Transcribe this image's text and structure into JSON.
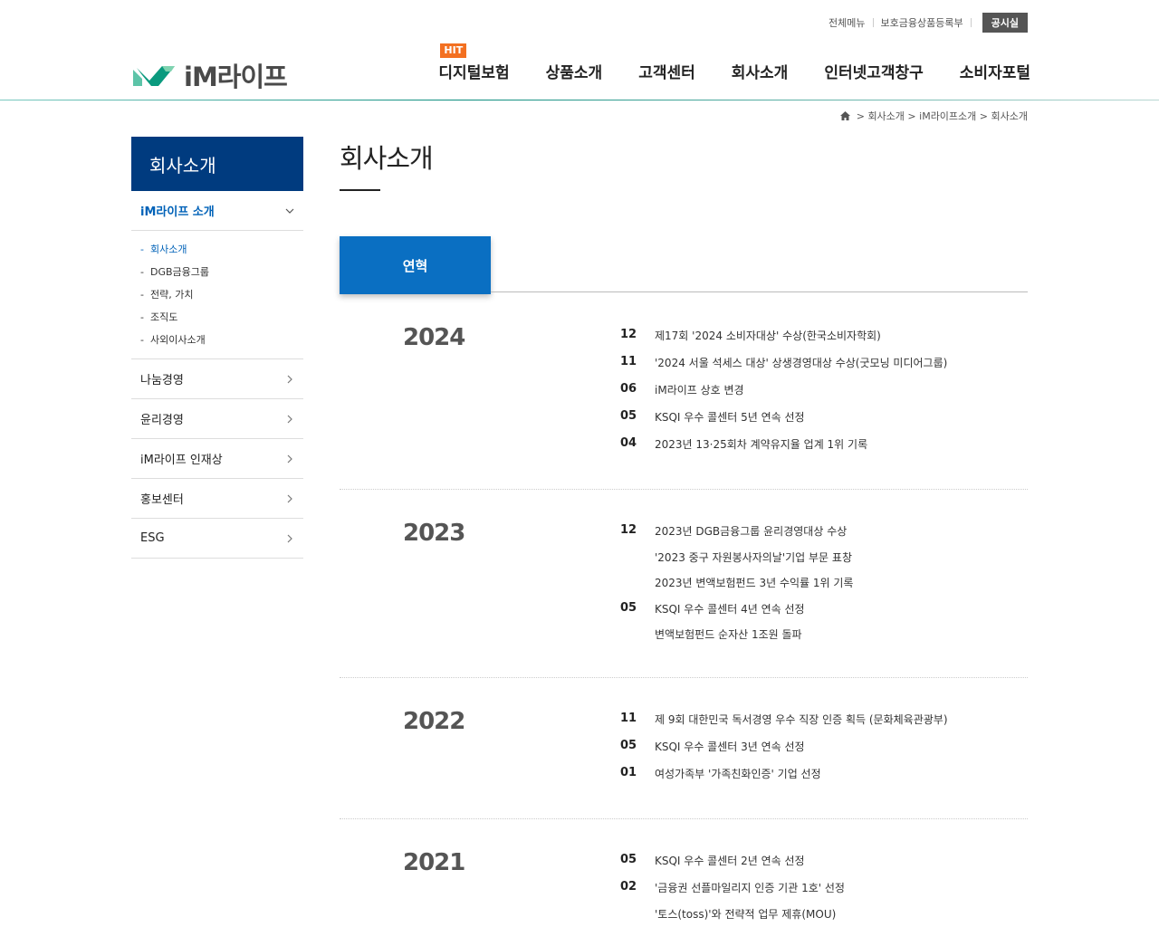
{
  "util": {
    "all_menu": "전체메뉴",
    "protected": "보호금융상품등록부",
    "disclosure": "공시실"
  },
  "logo": {
    "text": "iM라이프"
  },
  "gnb": {
    "hit_badge": "HIT",
    "items": [
      "디지털보험",
      "상품소개",
      "고객센터",
      "회사소개",
      "인터넷고객창구",
      "소비자포털"
    ]
  },
  "breadcrumb": {
    "home_icon": "home-icon",
    "items": [
      "회사소개",
      "iM라이프소개",
      "회사소개"
    ]
  },
  "lnb": {
    "title": "회사소개",
    "active": "iM라이프 소개",
    "subs": [
      "회사소개",
      "DGB금융그룹",
      "전략, 가치",
      "조직도",
      "사외이사소개"
    ],
    "items": [
      "나눔경영",
      "윤리경영",
      "iM라이프 인재상",
      "홍보센터",
      "ESG"
    ]
  },
  "page": {
    "title": "회사소개",
    "tab": "연혁"
  },
  "history": [
    {
      "year": "2024",
      "events": [
        {
          "m": "12",
          "t": "제17회 '2024 소비자대상' 수상(한국소비자학회)"
        },
        {
          "m": "11",
          "t": "'2024 서울 석세스 대상' 상생경영대상 수상(굿모닝 미디어그룹)"
        },
        {
          "m": "06",
          "t": "iM라이프 상호 변경"
        },
        {
          "m": "05",
          "t": "KSQI 우수 콜센터 5년 연속 선정"
        },
        {
          "m": "04",
          "t": "2023년 13·25회차 계약유지율 업계 1위 기록"
        }
      ]
    },
    {
      "year": "2023",
      "events": [
        {
          "m": "12",
          "t": "2023년 DGB금융그룹 윤리경영대상 수상"
        },
        {
          "m": "",
          "t": "'2023 중구 자원봉사자의날'기업 부문 표창"
        },
        {
          "m": "",
          "t": "2023년 변액보험펀드 3년 수익률 1위 기록"
        },
        {
          "m": "05",
          "t": "KSQI 우수 콜센터 4년 연속 선정"
        },
        {
          "m": "",
          "t": "변액보험펀드 순자산 1조원 돌파"
        }
      ]
    },
    {
      "year": "2022",
      "events": [
        {
          "m": "11",
          "t": "제 9회 대한민국 독서경영 우수 직장 인증 획득 (문화체육관광부)"
        },
        {
          "m": "05",
          "t": "KSQI 우수 콜센터 3년 연속 선정"
        },
        {
          "m": "01",
          "t": "여성가족부 '가족친화인증' 기업 선정"
        }
      ]
    },
    {
      "year": "2021",
      "events": [
        {
          "m": "05",
          "t": "KSQI 우수 콜센터 2년 연속 선정"
        },
        {
          "m": "02",
          "t": "'금융권 선플마일리지 인증 기관 1호' 선정"
        },
        {
          "m": "",
          "t": "'토스(toss)'와 전략적 업무 제휴(MOU)"
        }
      ]
    }
  ]
}
